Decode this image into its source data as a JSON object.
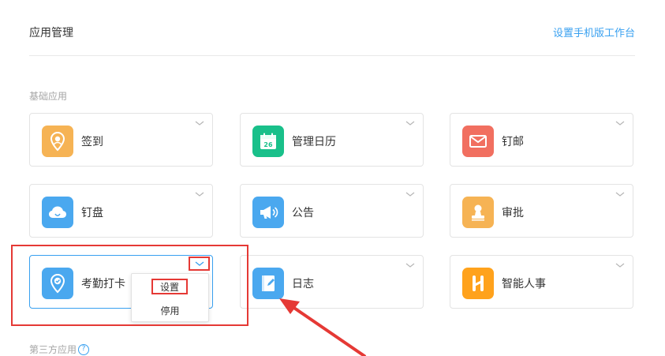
{
  "header": {
    "title": "应用管理",
    "mobile_link": "设置手机版工作台"
  },
  "sections": {
    "basic_label": "基础应用",
    "third_party_label": "第三方应用"
  },
  "apps": [
    {
      "name": "签到",
      "icon": "location-pin-icon",
      "color": "#f6b354"
    },
    {
      "name": "管理日历",
      "icon": "calendar-icon",
      "color": "#19c08a",
      "calendar_day": "26"
    },
    {
      "name": "钉邮",
      "icon": "mail-icon",
      "color": "#f16f60"
    },
    {
      "name": "钉盘",
      "icon": "cloud-icon",
      "color": "#4aa8ef"
    },
    {
      "name": "公告",
      "icon": "megaphone-icon",
      "color": "#4aa8ef"
    },
    {
      "name": "审批",
      "icon": "approval-stamp-icon",
      "color": "#f6b354"
    },
    {
      "name": "考勤打卡",
      "icon": "attendance-pin-icon",
      "color": "#4aa8ef"
    },
    {
      "name": "日志",
      "icon": "notebook-icon",
      "color": "#4aa8ef"
    },
    {
      "name": "智能人事",
      "icon": "hr-icon",
      "color": "#ffa21c"
    }
  ],
  "dropdown": {
    "settings": "设置",
    "disable": "停用"
  },
  "colors": {
    "accent": "#38a0f0",
    "annotation_red": "#e53935"
  }
}
